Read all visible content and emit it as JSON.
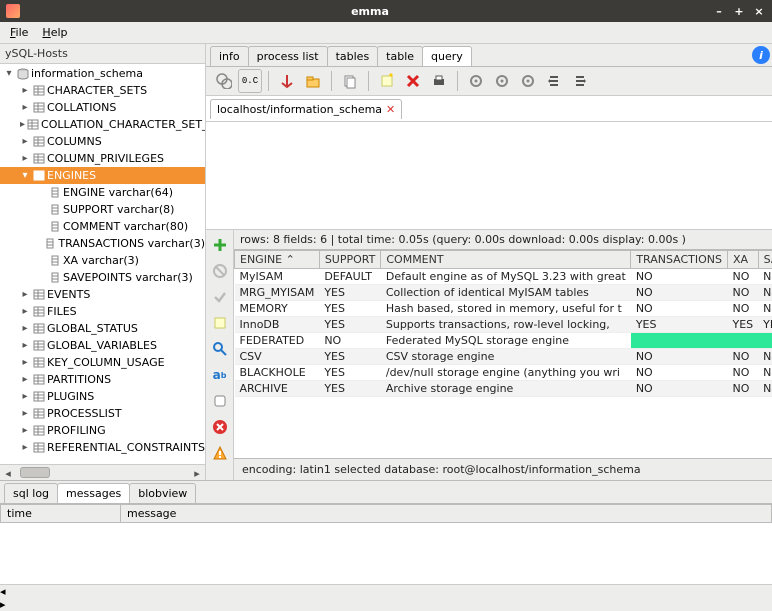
{
  "window": {
    "title": "emma"
  },
  "menubar": {
    "file": "File",
    "help": "Help"
  },
  "sidebar": {
    "header": "ySQL-Hosts",
    "items": [
      {
        "label": "information_schema",
        "indent": 1,
        "expanded": true,
        "icon": "db"
      },
      {
        "label": "CHARACTER_SETS",
        "indent": 2,
        "expandable": true,
        "icon": "table"
      },
      {
        "label": "COLLATIONS",
        "indent": 2,
        "expandable": true,
        "icon": "table"
      },
      {
        "label": "COLLATION_CHARACTER_SET_",
        "indent": 2,
        "expandable": true,
        "icon": "table"
      },
      {
        "label": "COLUMNS",
        "indent": 2,
        "expandable": true,
        "icon": "table"
      },
      {
        "label": "COLUMN_PRIVILEGES",
        "indent": 2,
        "expandable": true,
        "icon": "table"
      },
      {
        "label": "ENGINES",
        "indent": 2,
        "expanded": true,
        "icon": "table",
        "selected": true
      },
      {
        "label": "ENGINE varchar(64)",
        "indent": 3,
        "icon": "col"
      },
      {
        "label": "SUPPORT varchar(8)",
        "indent": 3,
        "icon": "col"
      },
      {
        "label": "COMMENT varchar(80)",
        "indent": 3,
        "icon": "col"
      },
      {
        "label": "TRANSACTIONS varchar(3)",
        "indent": 3,
        "icon": "col"
      },
      {
        "label": "XA varchar(3)",
        "indent": 3,
        "icon": "col"
      },
      {
        "label": "SAVEPOINTS varchar(3)",
        "indent": 3,
        "icon": "col"
      },
      {
        "label": "EVENTS",
        "indent": 2,
        "expandable": true,
        "icon": "table"
      },
      {
        "label": "FILES",
        "indent": 2,
        "expandable": true,
        "icon": "table"
      },
      {
        "label": "GLOBAL_STATUS",
        "indent": 2,
        "expandable": true,
        "icon": "table"
      },
      {
        "label": "GLOBAL_VARIABLES",
        "indent": 2,
        "expandable": true,
        "icon": "table"
      },
      {
        "label": "KEY_COLUMN_USAGE",
        "indent": 2,
        "expandable": true,
        "icon": "table"
      },
      {
        "label": "PARTITIONS",
        "indent": 2,
        "expandable": true,
        "icon": "table"
      },
      {
        "label": "PLUGINS",
        "indent": 2,
        "expandable": true,
        "icon": "table"
      },
      {
        "label": "PROCESSLIST",
        "indent": 2,
        "expandable": true,
        "icon": "table"
      },
      {
        "label": "PROFILING",
        "indent": 2,
        "expandable": true,
        "icon": "table"
      },
      {
        "label": "REFERENTIAL_CONSTRAINTS",
        "indent": 2,
        "expandable": true,
        "icon": "table"
      }
    ]
  },
  "right_tabs": [
    "info",
    "process list",
    "tables",
    "table",
    "query"
  ],
  "right_active_tab": 4,
  "breadcrumb": {
    "label": "localhost/information_schema"
  },
  "result_stats": "rows: 8 fields: 6 | total time: 0.05s (query: 0.00s download: 0.00s display: 0.00s )",
  "columns": [
    "ENGINE",
    "SUPPORT",
    "COMMENT",
    "TRANSACTIONS",
    "XA",
    "SAVEPOINT"
  ],
  "rows": [
    {
      "c": [
        "MyISAM",
        "DEFAULT",
        "Default engine as of MySQL 3.23 with great",
        "NO",
        "NO",
        "NO"
      ]
    },
    {
      "c": [
        "MRG_MYISAM",
        "YES",
        "Collection of identical MyISAM tables",
        "NO",
        "NO",
        "NO"
      ]
    },
    {
      "c": [
        "MEMORY",
        "YES",
        "Hash based, stored in memory, useful for t",
        "NO",
        "NO",
        "NO"
      ]
    },
    {
      "c": [
        "InnoDB",
        "YES",
        "Supports transactions, row-level locking,",
        "YES",
        "YES",
        "YES"
      ]
    },
    {
      "c": [
        "FEDERATED",
        "NO",
        "Federated MySQL storage engine",
        "",
        "",
        ""
      ],
      "highlight": [
        3,
        4,
        5
      ]
    },
    {
      "c": [
        "CSV",
        "YES",
        "CSV storage engine",
        "NO",
        "NO",
        "NO"
      ]
    },
    {
      "c": [
        "BLACKHOLE",
        "YES",
        "/dev/null storage engine (anything you wri",
        "NO",
        "NO",
        "NO"
      ]
    },
    {
      "c": [
        "ARCHIVE",
        "YES",
        "Archive storage engine",
        "NO",
        "NO",
        "NO"
      ]
    }
  ],
  "status_line": "encoding: latin1  selected database: root@localhost/information_schema",
  "bottom_tabs": [
    "sql log",
    "messages",
    "blobview"
  ],
  "bottom_active_tab": 1,
  "log_columns": [
    "time",
    "message"
  ]
}
